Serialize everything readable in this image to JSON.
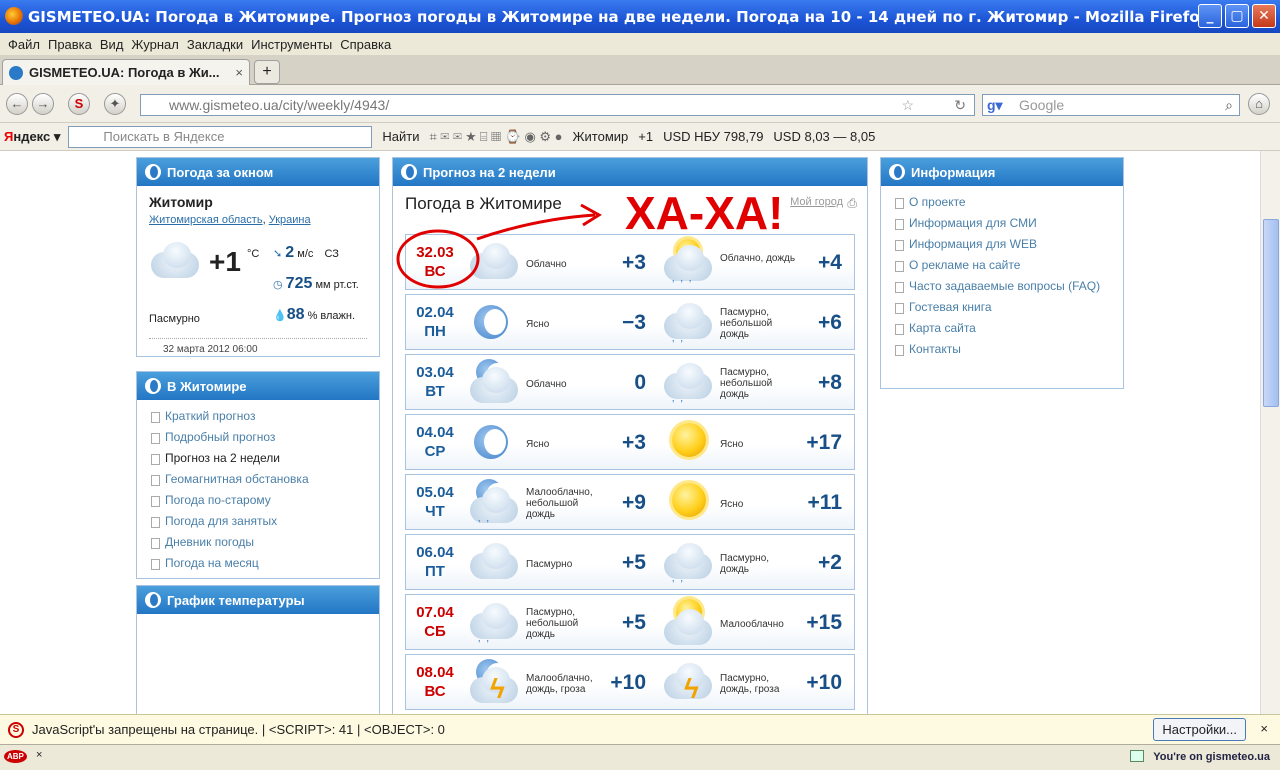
{
  "window": {
    "title": "GISMETEO.UA: Погода в Житомире. Прогноз погоды в Житомире на две недели. Погода на 10 - 14 дней по г. Житомир - Mozilla Firefox"
  },
  "menu": [
    "Файл",
    "Правка",
    "Вид",
    "Журнал",
    "Закладки",
    "Инструменты",
    "Справка"
  ],
  "tab": {
    "label": "GISMETEO.UA: Погода в Жи...",
    "close": "×",
    "new": "+"
  },
  "url": "www.gismeteo.ua/city/weekly/4943/",
  "search_placeholder": "Google",
  "yandex": {
    "logo_y": "Я",
    "logo_rest": "ндекс",
    "placeholder": "Поискать в Яндексе",
    "find": "Найти",
    "city": "Житомир",
    "temp": "+1",
    "nbu": "USD НБУ 798,79",
    "usd": "USD 8,03 — 8,05"
  },
  "now": {
    "header": "Погода за окном",
    "city": "Житомир",
    "region": "Житомирская область",
    "country": "Украина",
    "temp": "+1",
    "temp_unit": "°C",
    "wind_speed": "2",
    "wind_unit": "м/с",
    "wind_dir": "СЗ",
    "pressure": "725",
    "pressure_unit": "мм рт.ст.",
    "humidity": "88",
    "humidity_unit": "% влажн.",
    "condition": "Пасмурно",
    "timestamp": "32 марта 2012 06:00"
  },
  "city_menu": {
    "header": "В Житомире",
    "items": [
      "Краткий прогноз",
      "Подробный прогноз",
      "Прогноз на 2 недели",
      "Геомагнитная обстановка",
      "Погода по-старому",
      "Погода для занятых",
      "Дневник погоды",
      "Погода на месяц"
    ]
  },
  "graph": {
    "header": "График температуры"
  },
  "forecast": {
    "header": "Прогноз на 2 недели",
    "title": "Погода в Житомире",
    "my_link": "Мой город",
    "annotation": "ХА-ХА!",
    "days": [
      {
        "date": "32.03",
        "dow": "ВС",
        "red": true,
        "night_desc": "Облачно",
        "night_temp": "+3",
        "day_desc": "Облачно, дождь",
        "day_temp": "+4"
      },
      {
        "date": "02.04",
        "dow": "ПН",
        "red": false,
        "night_desc": "Ясно",
        "night_temp": "−3",
        "day_desc": "Пасмурно, небольшой дождь",
        "day_temp": "+6"
      },
      {
        "date": "03.04",
        "dow": "ВТ",
        "red": false,
        "night_desc": "Облачно",
        "night_temp": "0",
        "day_desc": "Пасмурно, небольшой дождь",
        "day_temp": "+8"
      },
      {
        "date": "04.04",
        "dow": "СР",
        "red": false,
        "night_desc": "Ясно",
        "night_temp": "+3",
        "day_desc": "Ясно",
        "day_temp": "+17"
      },
      {
        "date": "05.04",
        "dow": "ЧТ",
        "red": false,
        "night_desc": "Малооблачно, небольшой дождь",
        "night_temp": "+9",
        "day_desc": "Ясно",
        "day_temp": "+11"
      },
      {
        "date": "06.04",
        "dow": "ПТ",
        "red": false,
        "night_desc": "Пасмурно",
        "night_temp": "+5",
        "day_desc": "Пасмурно, дождь",
        "day_temp": "+2"
      },
      {
        "date": "07.04",
        "dow": "СБ",
        "red": true,
        "night_desc": "Пасмурно, небольшой дождь",
        "night_temp": "+5",
        "day_desc": "Малооблачно",
        "day_temp": "+15"
      },
      {
        "date": "08.04",
        "dow": "ВС",
        "red": true,
        "night_desc": "Малооблачно, дождь, гроза",
        "night_temp": "+10",
        "day_desc": "Пасмурно, дождь, гроза",
        "day_temp": "+10"
      }
    ]
  },
  "info": {
    "header": "Информация",
    "items": [
      "О проекте",
      "Информация для СМИ",
      "Информация для WEB",
      "О рекламе на сайте",
      "Часто задаваемые вопросы (FAQ)",
      "Гостевая книга",
      "Карта сайта",
      "Контакты"
    ]
  },
  "status": {
    "text": "JavaScript'ы запрещены на странице. | <SCRIPT>: 41 | <OBJECT>: 0",
    "settings": "Настройки...",
    "close": "×"
  },
  "bottom": {
    "abp": "ABP",
    "close": "×",
    "right": "You're on gismeteo.ua"
  }
}
